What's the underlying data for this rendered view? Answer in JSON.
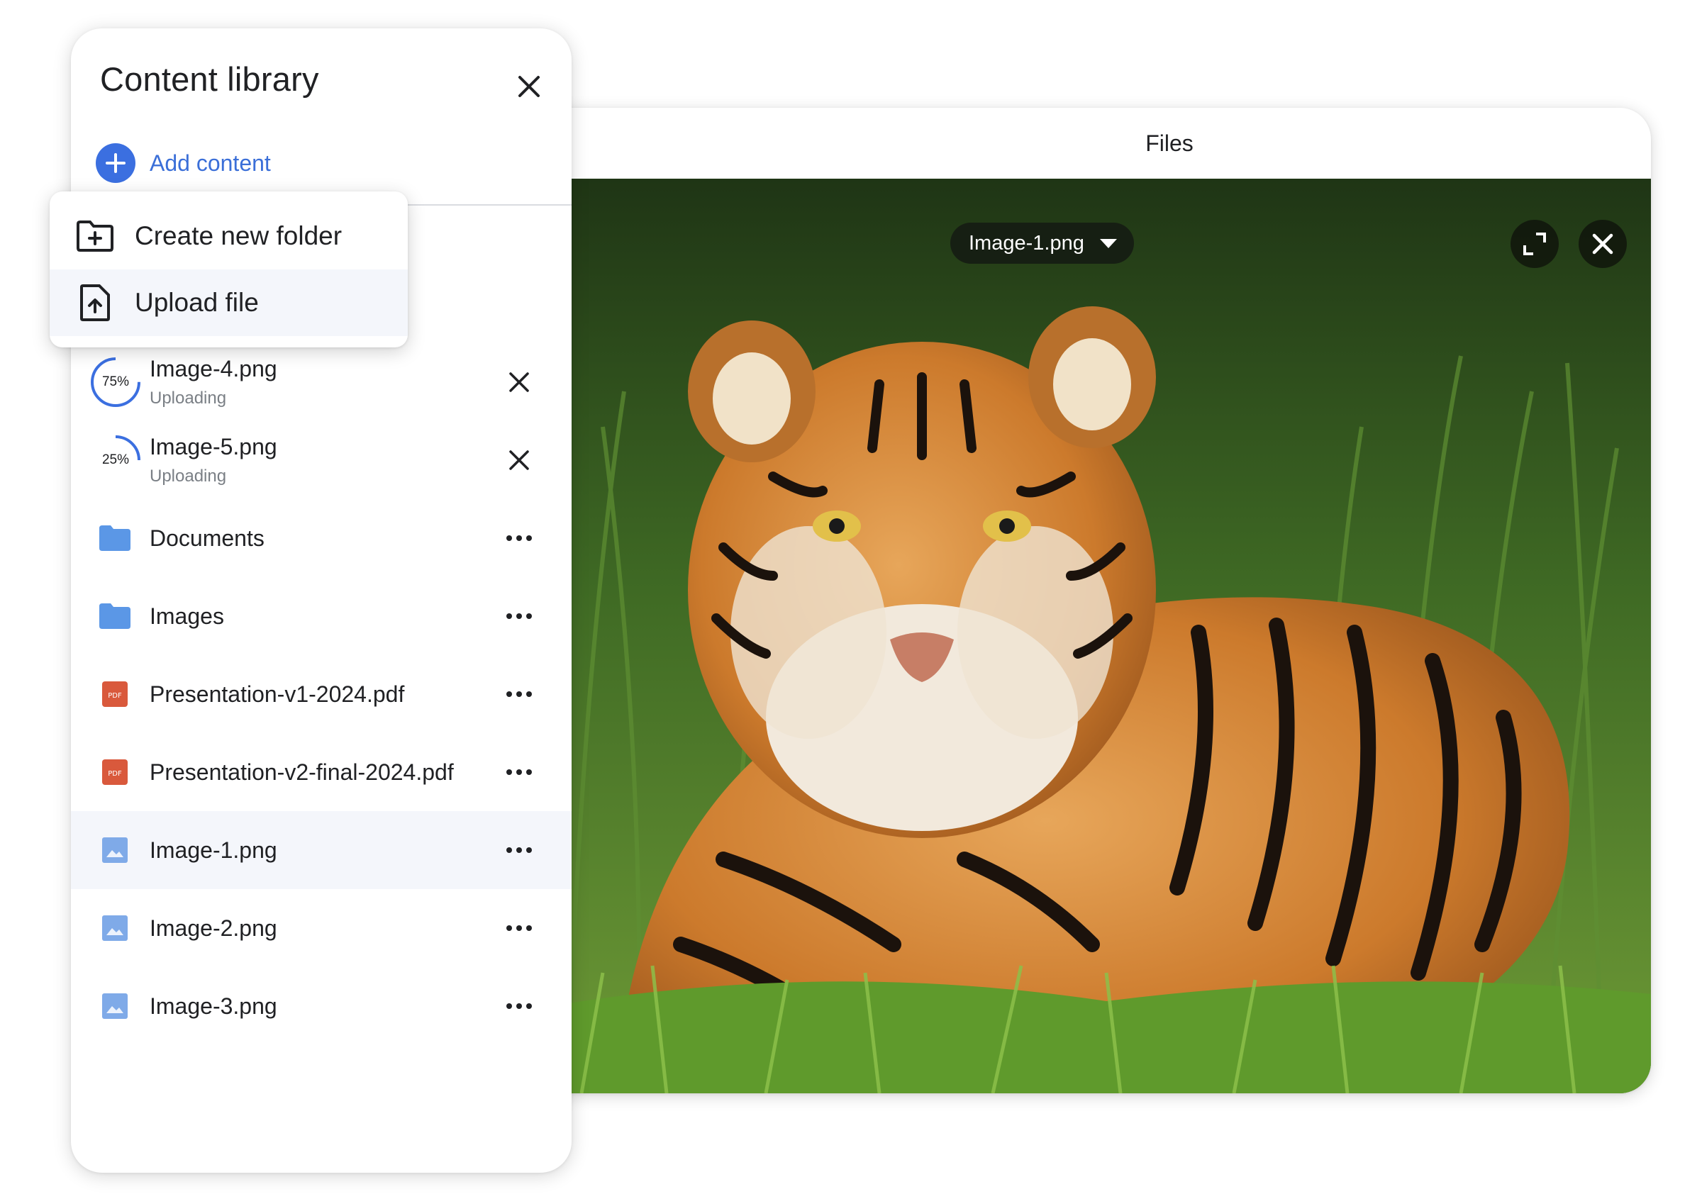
{
  "viewer": {
    "title": "Files",
    "selected_file": "Image-1.png",
    "expand_icon": "expand-icon",
    "close_icon": "close-icon"
  },
  "library": {
    "title": "Content library",
    "add_content_label": "Add content",
    "close_icon": "close-icon"
  },
  "menu": {
    "items": [
      {
        "label": "Create new folder",
        "icon": "folder-plus-icon"
      },
      {
        "label": "Upload file",
        "icon": "file-upload-icon"
      }
    ]
  },
  "uploads": [
    {
      "name": "Image-4.png",
      "status": "Uploading",
      "percent_label": "75%",
      "progress": 0.75
    },
    {
      "name": "Image-5.png",
      "status": "Uploading",
      "percent_label": "25%",
      "progress": 0.25
    }
  ],
  "files": [
    {
      "name": "Documents",
      "type": "folder"
    },
    {
      "name": "Images",
      "type": "folder"
    },
    {
      "name": "Presentation-v1-2024.pdf",
      "type": "pdf",
      "badge": "PDF"
    },
    {
      "name": "Presentation-v2-final-2024.pdf",
      "type": "pdf",
      "badge": "PDF"
    },
    {
      "name": "Image-1.png",
      "type": "image",
      "selected": true
    },
    {
      "name": "Image-2.png",
      "type": "image"
    },
    {
      "name": "Image-3.png",
      "type": "image"
    }
  ],
  "colors": {
    "accent": "#3b6fe0",
    "folder": "#5b97e6",
    "pdf": "#d9593c",
    "image": "#7faae8"
  }
}
